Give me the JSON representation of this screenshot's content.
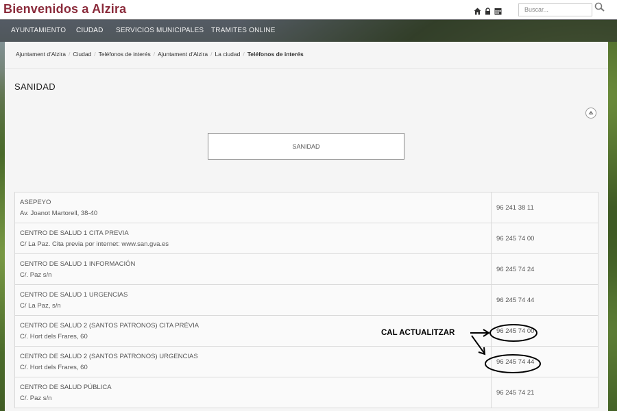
{
  "site": {
    "title": "Bienvenidos a Alzira"
  },
  "top_icons": [
    "home-icon",
    "lock-icon",
    "calendar-icon"
  ],
  "search": {
    "placeholder": "Buscar..."
  },
  "nav": {
    "items": [
      {
        "label": "AYUNTAMIENTO"
      },
      {
        "label": "CIUDAD"
      },
      {
        "label": "SERVICIOS MUNICIPALES"
      },
      {
        "label": "TRAMITES ONLINE"
      }
    ]
  },
  "breadcrumb": [
    "Ajuntament d'Alzira",
    "Ciudad",
    "Teléfonos de interés",
    "Ajuntament d'Alzira",
    "La ciudad",
    "Teléfonos de interés"
  ],
  "page": {
    "title": "SANIDAD",
    "section_label": "SANIDAD"
  },
  "rows": [
    {
      "name": "ASEPEYO",
      "address": "Av. Joanot Martorell, 38-40",
      "phone": "96 241 38 11"
    },
    {
      "name": "CENTRO DE SALUD 1 CITA PREVIA",
      "address": "C/ La Paz. Cita previa por internet: www.san.gva.es",
      "phone": "96 245 74 00"
    },
    {
      "name": "CENTRO DE SALUD 1 INFORMACIÓN",
      "address": "C/. Paz s/n",
      "phone": "96 245 74 24"
    },
    {
      "name": "CENTRO DE SALUD 1 URGENCIAS",
      "address": "C/ La Paz, s/n",
      "phone": "96 245 74 44"
    },
    {
      "name": "CENTRO DE SALUD 2 (SANTOS PATRONOS) CITA PRÉVIA",
      "address": "C/. Hort dels Frares, 60",
      "phone": "96 245 74 00"
    },
    {
      "name": "CENTRO DE SALUD 2 (SANTOS PATRONOS) URGENCIAS",
      "address": "C/. Hort dels Frares, 60",
      "phone": "96 245 74 44"
    },
    {
      "name": "CENTRO DE SALUD PÚBLICA",
      "address": "C/. Paz s/n",
      "phone": "96 245 74 21"
    }
  ],
  "annotation": {
    "text": "CAL ACTUALITZAR"
  },
  "colors": {
    "brand": "#8a2a3a",
    "nav_bg": "#3a3a40"
  }
}
